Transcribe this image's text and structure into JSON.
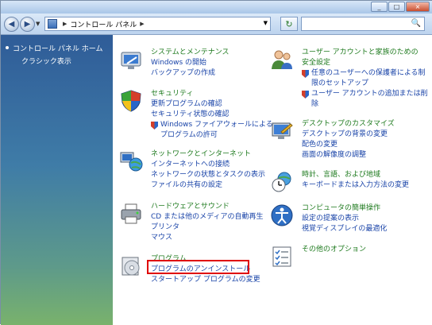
{
  "window": {
    "buttons": {
      "minimize": "_",
      "maximize": "□",
      "close": "×"
    }
  },
  "address": {
    "back_glyph": "◀",
    "forward_glyph": "▶",
    "breadcrumb_sep": "▶",
    "crumb": "コントロール パネル",
    "crumb_sep": "▶",
    "dropdown": "▼",
    "refresh_glyph": "↻",
    "search_placeholder": "",
    "search_glyph": "🔍"
  },
  "sidebar": {
    "home": "コントロール パネル ホーム",
    "classic": "クラシック表示"
  },
  "categories": {
    "system": {
      "title": "システムとメンテナンス",
      "links": [
        "Windows の開始",
        "バックアップの作成"
      ]
    },
    "security": {
      "title": "セキュリティ",
      "links": [
        "更新プログラムの確認",
        "セキュリティ状態の確認"
      ],
      "shield_links": [
        "Windows ファイアウォールによる",
        "プログラムの許可"
      ]
    },
    "network": {
      "title": "ネットワークとインターネット",
      "links": [
        "インターネットへの接続",
        "ネットワークの状態とタスクの表示",
        "ファイルの共有の設定"
      ]
    },
    "hardware": {
      "title": "ハードウェアとサウンド",
      "links": [
        "CD または他のメディアの自動再生",
        "プリンタ",
        "マウス"
      ]
    },
    "programs": {
      "title": "プログラム",
      "links": [
        "プログラムのアンインストール",
        "スタートアップ プログラムの変更"
      ]
    },
    "users": {
      "title": "ユーザー アカウントと家族のための",
      "title2": "安全設定",
      "shield_links": [
        [
          "任意のユーザーへの保護者による制",
          "限のセットアップ"
        ],
        [
          "ユーザー アカウントの追加または削",
          "除"
        ]
      ]
    },
    "appearance": {
      "title": "デスクトップのカスタマイズ",
      "links": [
        "デスクトップの背景の変更",
        "配色の変更",
        "画面の解像度の調整"
      ]
    },
    "clock": {
      "title": "時計、言語、および地域",
      "links": [
        "キーボードまたは入力方法の変更"
      ]
    },
    "ease": {
      "title": "コンピュータの簡単操作",
      "links": [
        "設定の提案の表示",
        "視覚ディスプレイの最適化"
      ]
    },
    "other": {
      "title": "その他のオプション"
    }
  },
  "colors": {
    "highlight_box": "#e00000",
    "link": "#1a44a8",
    "category_title": "#1e7a1e"
  }
}
